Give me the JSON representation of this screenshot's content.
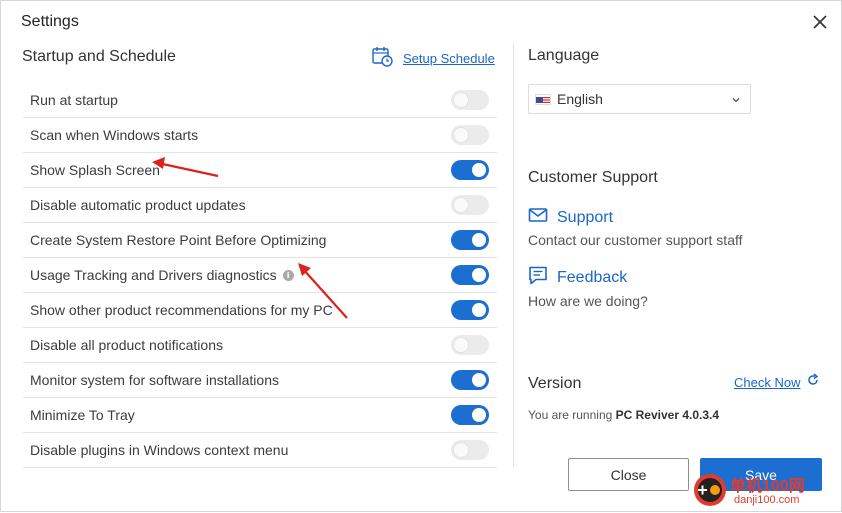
{
  "window": {
    "title": "Settings"
  },
  "startup": {
    "title": "Startup and Schedule",
    "setup_link": "Setup Schedule",
    "rows": [
      {
        "label": "Run at startup",
        "enabled": false
      },
      {
        "label": "Scan when Windows starts",
        "enabled": false
      },
      {
        "label": "Show Splash Screen",
        "enabled": true
      },
      {
        "label": "Disable automatic product updates",
        "enabled": false
      },
      {
        "label": "Create System Restore Point Before Optimizing",
        "enabled": true
      },
      {
        "label": "Usage Tracking and Drivers diagnostics",
        "enabled": true,
        "info": true
      },
      {
        "label": "Show other product recommendations for my PC",
        "enabled": true
      },
      {
        "label": "Disable all product notifications",
        "enabled": false
      },
      {
        "label": "Monitor system for software installations",
        "enabled": true
      },
      {
        "label": "Minimize To Tray",
        "enabled": true
      },
      {
        "label": "Disable plugins in Windows context menu",
        "enabled": false
      }
    ]
  },
  "language": {
    "title": "Language",
    "selected": "English",
    "flag_icon": "us-flag-icon"
  },
  "support": {
    "title": "Customer Support",
    "support_label": "Support",
    "support_desc": "Contact our customer support staff",
    "feedback_label": "Feedback",
    "feedback_desc": "How are we doing?"
  },
  "version": {
    "title": "Version",
    "check_now": "Check Now",
    "running_prefix": "You are running ",
    "product": "PC Reviver 4.0.3.4"
  },
  "buttons": {
    "close": "Close",
    "save": "Save"
  },
  "watermark": {
    "text": "单机100网",
    "url": "danji100.com"
  },
  "colors": {
    "accent": "#1c6fd1",
    "link": "#1a66c9",
    "annotation": "#d9231b"
  }
}
